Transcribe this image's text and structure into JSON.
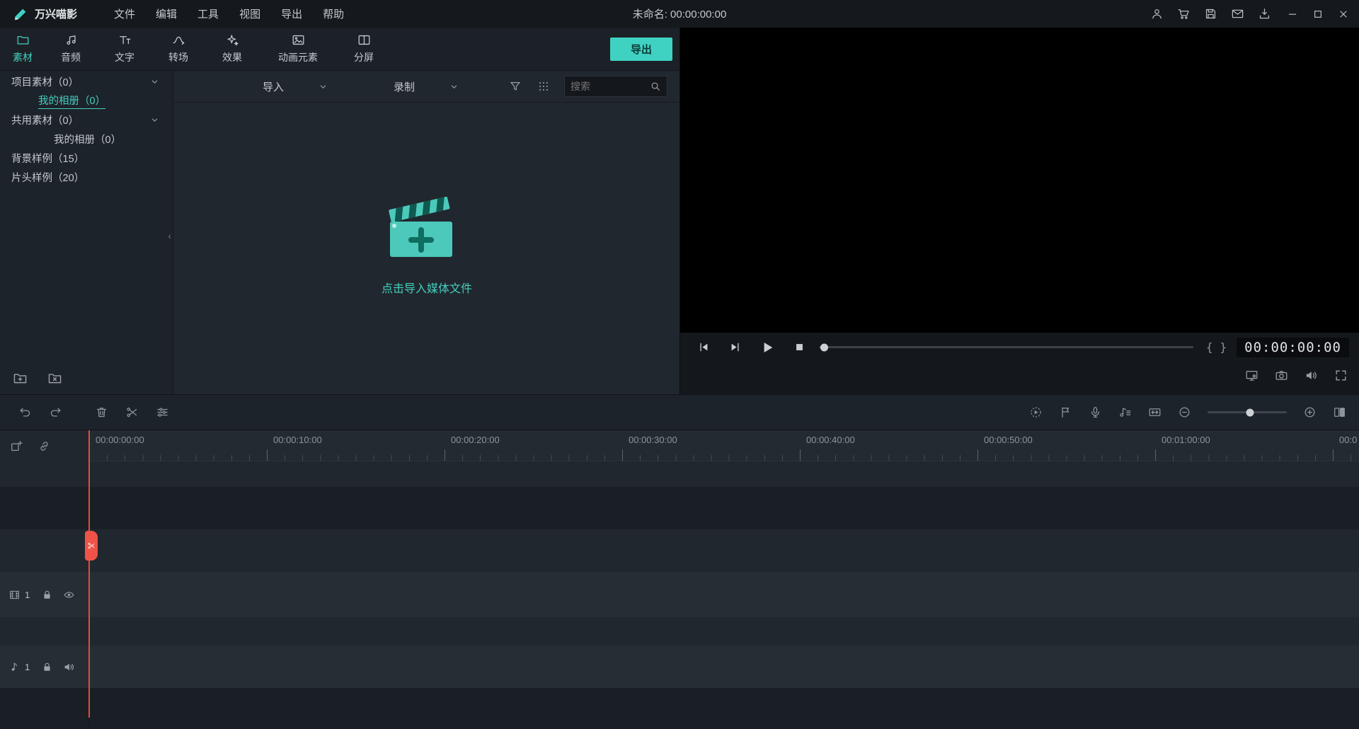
{
  "titlebar": {
    "app_name": "万兴喵影",
    "menus": [
      "文件",
      "编辑",
      "工具",
      "视图",
      "导出",
      "帮助"
    ],
    "document_title": "未命名: 00:00:00:00"
  },
  "tabbar": {
    "tabs": [
      {
        "label": "素材",
        "active": true
      },
      {
        "label": "音频"
      },
      {
        "label": "文字"
      },
      {
        "label": "转场"
      },
      {
        "label": "效果"
      },
      {
        "label": "动画元素"
      },
      {
        "label": "分屏"
      }
    ],
    "export_button": "导出"
  },
  "sidebar": {
    "items": [
      {
        "label": "项目素材（0）",
        "expandable": true
      },
      {
        "label": "我的相册（0）",
        "selected": true
      },
      {
        "label": "共用素材（0）",
        "expandable": true
      },
      {
        "label": "我的相册（0）"
      },
      {
        "label": "背景样例（15）"
      },
      {
        "label": "片头样例（20）"
      }
    ]
  },
  "media_panel": {
    "import_label": "导入",
    "record_label": "录制",
    "search_placeholder": "搜索",
    "empty_prompt": "点击导入媒体文件"
  },
  "preview": {
    "timecode": "00:00:00:00",
    "mark_in": "{",
    "mark_out": "}"
  },
  "timeline": {
    "ruler_labels": [
      "00:00:00:00",
      "00:00:10:00",
      "00:00:20:00",
      "00:00:30:00",
      "00:00:40:00",
      "00:00:50:00",
      "00:01:00:00",
      "00:0"
    ],
    "video_track": {
      "number": "1"
    },
    "audio_track": {
      "number": "1"
    }
  },
  "colors": {
    "accent": "#45cfbf",
    "export_button": "#3fd2c2",
    "playhead": "#ee5247",
    "titlebar_bg": "#15181c",
    "panel_bg": "#21272e"
  },
  "icons": {
    "titlebar": [
      "account-icon",
      "cart-icon",
      "save-icon",
      "mail-icon",
      "download-icon",
      "minimize-icon",
      "maximize-icon",
      "close-icon"
    ],
    "tabs": [
      "folder-icon",
      "music-icon",
      "text-icon",
      "transition-icon",
      "effects-icon",
      "elements-icon",
      "split-screen-icon"
    ],
    "sidebar": [
      "chevron-down-icon",
      "add-folder-icon",
      "delete-folder-icon"
    ],
    "media_toolbar": [
      "filter-icon",
      "grid-view-icon",
      "search-icon",
      "clapperboard-icon"
    ],
    "preview_controls": [
      "previous-frame-icon",
      "next-frame-icon",
      "play-icon",
      "stop-icon",
      "display-settings-icon",
      "snapshot-icon",
      "speaker-icon",
      "fullscreen-icon"
    ],
    "timeline_toolbar": [
      "undo-icon",
      "redo-icon",
      "trash-icon",
      "scissors-icon",
      "adjust-icon",
      "render-preview-icon",
      "marker-icon",
      "mic-icon",
      "audio-mixer-icon",
      "track-manager-icon",
      "zoom-out-icon",
      "zoom-in-icon",
      "panel-toggle-icon"
    ],
    "timeline": [
      "add-track-icon",
      "link-icon",
      "video-track-icon",
      "lock-icon",
      "eye-icon",
      "audio-track-icon",
      "playhead-scissors-icon"
    ]
  }
}
